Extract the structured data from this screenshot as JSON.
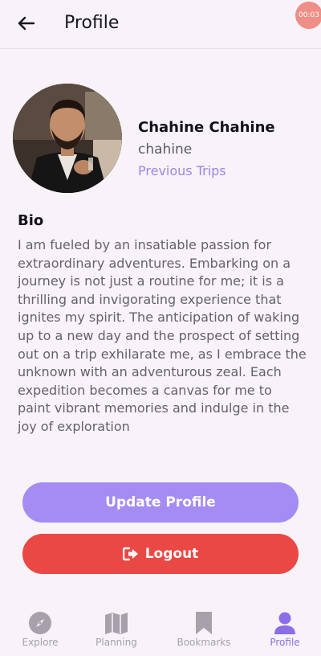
{
  "app_bar": {
    "title": "Profile",
    "timer": "00:03"
  },
  "profile": {
    "name": "Chahine Chahine",
    "username": "chahine",
    "previous_trips_label": "Previous Trips"
  },
  "bio": {
    "heading": "Bio",
    "text": "I am fueled by an insatiable passion for extraordinary adventures. Embarking on a journey is not just a routine for me; it is a thrilling and invigorating experience that ignites my spirit. The anticipation of waking up to a new day and the prospect of setting out on a trip exhilarate me, as I embrace the unknown with an adventurous zeal. Each expedition becomes a canvas for me to paint vibrant memories and indulge in the joy of exploration"
  },
  "actions": {
    "update_label": "Update Profile",
    "logout_label": "Logout"
  },
  "bottom_nav": {
    "items": [
      {
        "label": "Explore",
        "icon": "compass-icon",
        "active": false
      },
      {
        "label": "Planning",
        "icon": "map-icon",
        "active": false
      },
      {
        "label": "Bookmarks",
        "icon": "bookmark-icon",
        "active": false
      },
      {
        "label": "Profile",
        "icon": "person-icon",
        "active": true
      }
    ]
  },
  "colors": {
    "accent": "#a58cf3",
    "accent_text": "#9b86e8",
    "danger": "#ea4844",
    "background": "#f7f3f8"
  }
}
